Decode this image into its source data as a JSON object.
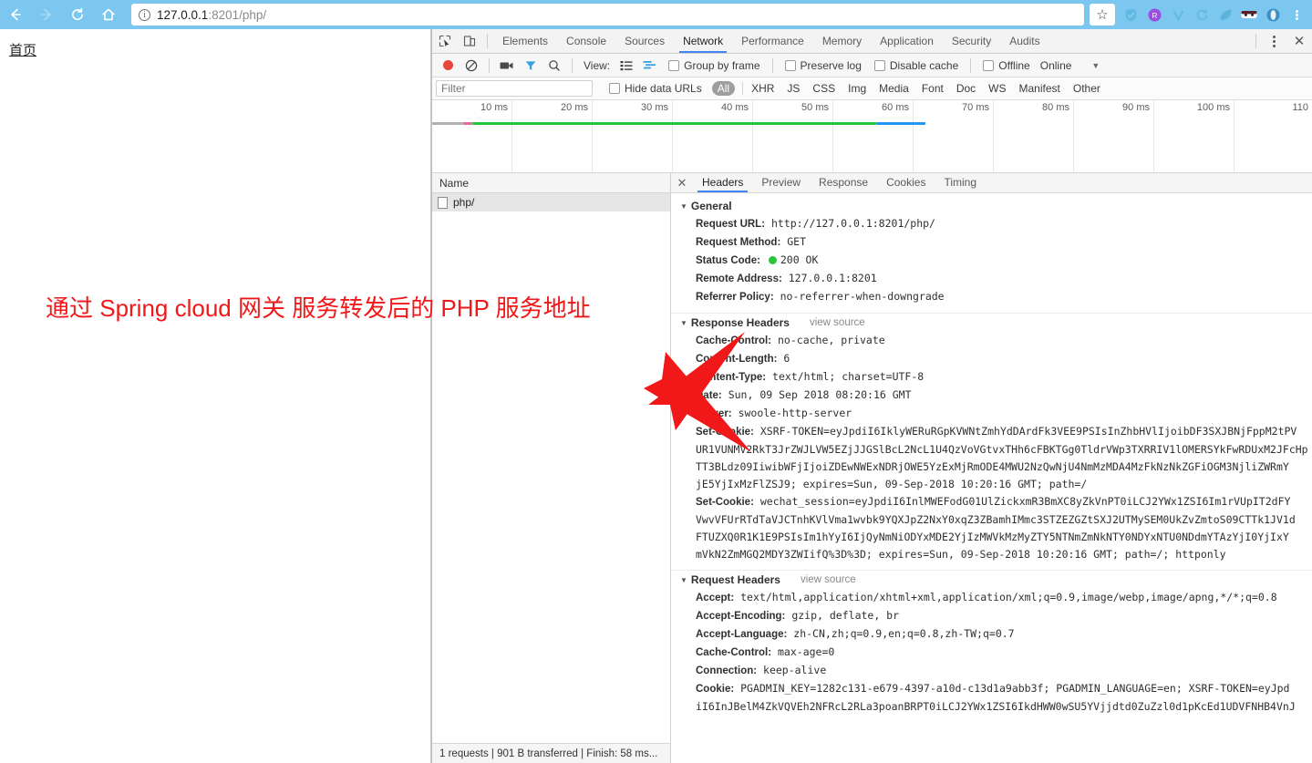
{
  "browser": {
    "back_icon": "back-arrow-icon",
    "forward_icon": "forward-arrow-icon",
    "reload_icon": "reload-icon",
    "home_icon": "home-icon",
    "url": "127.0.0.1:8201/php/",
    "url_host": "127.0.0.1",
    "url_rest": ":8201/php/",
    "security_icon": "info-circle-icon",
    "bookmark_icon": "star-icon",
    "menu_icon": "kebab-menu-icon"
  },
  "page": {
    "link_label": "首页",
    "annotation": "通过 Spring cloud 网关 服务转发后的 PHP 服务地址",
    "annotation_color": "#f01818"
  },
  "devtools": {
    "inspect_icon": "inspect-element-icon",
    "device_icon": "device-toolbar-icon",
    "more_icon": "kebab-menu-icon",
    "close_icon": "close-icon",
    "tabs": [
      {
        "label": "Elements",
        "active": false
      },
      {
        "label": "Console",
        "active": false
      },
      {
        "label": "Sources",
        "active": false
      },
      {
        "label": "Network",
        "active": true
      },
      {
        "label": "Performance",
        "active": false
      },
      {
        "label": "Memory",
        "active": false
      },
      {
        "label": "Application",
        "active": false
      },
      {
        "label": "Security",
        "active": false
      },
      {
        "label": "Audits",
        "active": false
      }
    ],
    "toolbar": {
      "record_icon": "record-stop-icon",
      "clear_icon": "clear-icon",
      "screenshot_icon": "camera-icon",
      "filter_icon": "funnel-icon",
      "search_icon": "search-icon",
      "view_label": "View:",
      "view_list_icon": "list-view-icon",
      "view_waterfall_icon": "waterfall-view-icon",
      "group_by_frame": "Group by frame",
      "preserve_log": "Preserve log",
      "disable_cache": "Disable cache",
      "offline": "Offline",
      "throttling": "Online",
      "throttling_caret": "chevron-down-icon"
    },
    "filterbar": {
      "filter_placeholder": "Filter",
      "filter_value": "",
      "hide_data_urls": "Hide data URLs",
      "types": [
        "All",
        "XHR",
        "JS",
        "CSS",
        "Img",
        "Media",
        "Font",
        "Doc",
        "WS",
        "Manifest",
        "Other"
      ]
    },
    "timeline": {
      "ticks": [
        "10 ms",
        "20 ms",
        "30 ms",
        "40 ms",
        "50 ms",
        "60 ms",
        "70 ms",
        "80 ms",
        "90 ms",
        "100 ms",
        "110"
      ],
      "bar_colors": {
        "stalled": "#b0b0b0",
        "dns": "#e06c9f",
        "wait": "#24c43b",
        "download": "#2196f3"
      }
    },
    "requests": {
      "column_header": "Name",
      "rows": [
        {
          "name": "php/",
          "icon": "document-icon",
          "selected": true
        }
      ]
    },
    "status_bar": "1 requests | 901 B transferred | Finish: 58 ms...",
    "detail_tabs": [
      {
        "label": "Headers",
        "active": true
      },
      {
        "label": "Preview",
        "active": false
      },
      {
        "label": "Response",
        "active": false
      },
      {
        "label": "Cookies",
        "active": false
      },
      {
        "label": "Timing",
        "active": false
      }
    ],
    "sections": [
      {
        "title": "General",
        "view_source": "",
        "rows": [
          {
            "key": "Request URL:",
            "value": "http://127.0.0.1:8201/php/"
          },
          {
            "key": "Request Method:",
            "value": "GET"
          },
          {
            "key": "Status Code:",
            "value": "200 OK",
            "status_dot": true
          },
          {
            "key": "Remote Address:",
            "value": "127.0.0.1:8201"
          },
          {
            "key": "Referrer Policy:",
            "value": "no-referrer-when-downgrade"
          }
        ]
      },
      {
        "title": "Response Headers",
        "view_source": "view source",
        "rows": [
          {
            "key": "Cache-Control:",
            "value": "no-cache, private"
          },
          {
            "key": "Content-Length:",
            "value": "6"
          },
          {
            "key": "Content-Type:",
            "value": "text/html; charset=UTF-8"
          },
          {
            "key": "Date:",
            "value": "Sun, 09 Sep 2018 08:20:16 GMT"
          },
          {
            "key": "Server:",
            "value": "swoole-http-server"
          },
          {
            "key": "Set-Cookie:",
            "value": "XSRF-TOKEN=eyJpdiI6IklyWERuRGpKVWNtZmhYdDArdFk3VEE9PSIsInZhbHVlIjoibDF3SXJBNjFppM2tPV"
          },
          {
            "cont": "UR1VUNMV2RkT3JrZWJLVW5EZjJJGSlBcL2NcL1U4QzVoVGtvxTHh6cFBKTGg0TldrVWp3TXRRIV1lOMERSYkFwRDUxM2JFcHp"
          },
          {
            "cont": "TT3BLdz09IiwibWFjIjoiZDEwNWExNDRjOWE5YzExMjRmODE4MWU2NzQwNjU4NmMzMDA4MzFkNzNkZGFiOGM3NjliZWRmY"
          },
          {
            "cont": "jE5YjIxMzFlZSJ9; expires=Sun, 09-Sep-2018 10:20:16 GMT; path=/"
          },
          {
            "key": "Set-Cookie:",
            "value": "wechat_session=eyJpdiI6InlMWEFodG01UlZickxmR3BmXC8yZkVnPT0iLCJ2YWx1ZSI6Im1rVUpIT2dFY"
          },
          {
            "cont": "VwvVFUrRTdTaVJCTnhKVlVma1wvbk9YQXJpZ2NxY0xqZ3ZBamhIMmc3STZEZGZtSXJ2UTMySEM0UkZvZmtoS09CTTk1JV1d"
          },
          {
            "cont": "FTUZXQ0R1K1E9PSIsIm1hYyI6IjQyNmNiODYxMDE2YjIzMWVkMzMyZTY5NTNmZmNkNTY0NDYxNTU0NDdmYTAzYjI0YjIxY"
          },
          {
            "cont": "mVkN2ZmMGQ2MDY3ZWIifQ%3D%3D; expires=Sun, 09-Sep-2018 10:20:16 GMT; path=/; httponly"
          }
        ]
      },
      {
        "title": "Request Headers",
        "view_source": "view source",
        "rows": [
          {
            "key": "Accept:",
            "value": "text/html,application/xhtml+xml,application/xml;q=0.9,image/webp,image/apng,*/*;q=0.8"
          },
          {
            "key": "Accept-Encoding:",
            "value": "gzip, deflate, br"
          },
          {
            "key": "Accept-Language:",
            "value": "zh-CN,zh;q=0.9,en;q=0.8,zh-TW;q=0.7"
          },
          {
            "key": "Cache-Control:",
            "value": "max-age=0"
          },
          {
            "key": "Connection:",
            "value": "keep-alive"
          },
          {
            "key": "Cookie:",
            "value": "PGADMIN_KEY=1282c131-e679-4397-a10d-c13d1a9abb3f; PGADMIN_LANGUAGE=en; XSRF-TOKEN=eyJpd"
          },
          {
            "cont": "iI6InJBelM4ZkVQVEh2NFRcL2RLa3poanBRPT0iLCJ2YWx1ZSI6IkdHWW0wSU5YVjjdtd0ZuZzl0d1pKcEd1UDVFNHB4VnJ"
          }
        ]
      }
    ]
  }
}
